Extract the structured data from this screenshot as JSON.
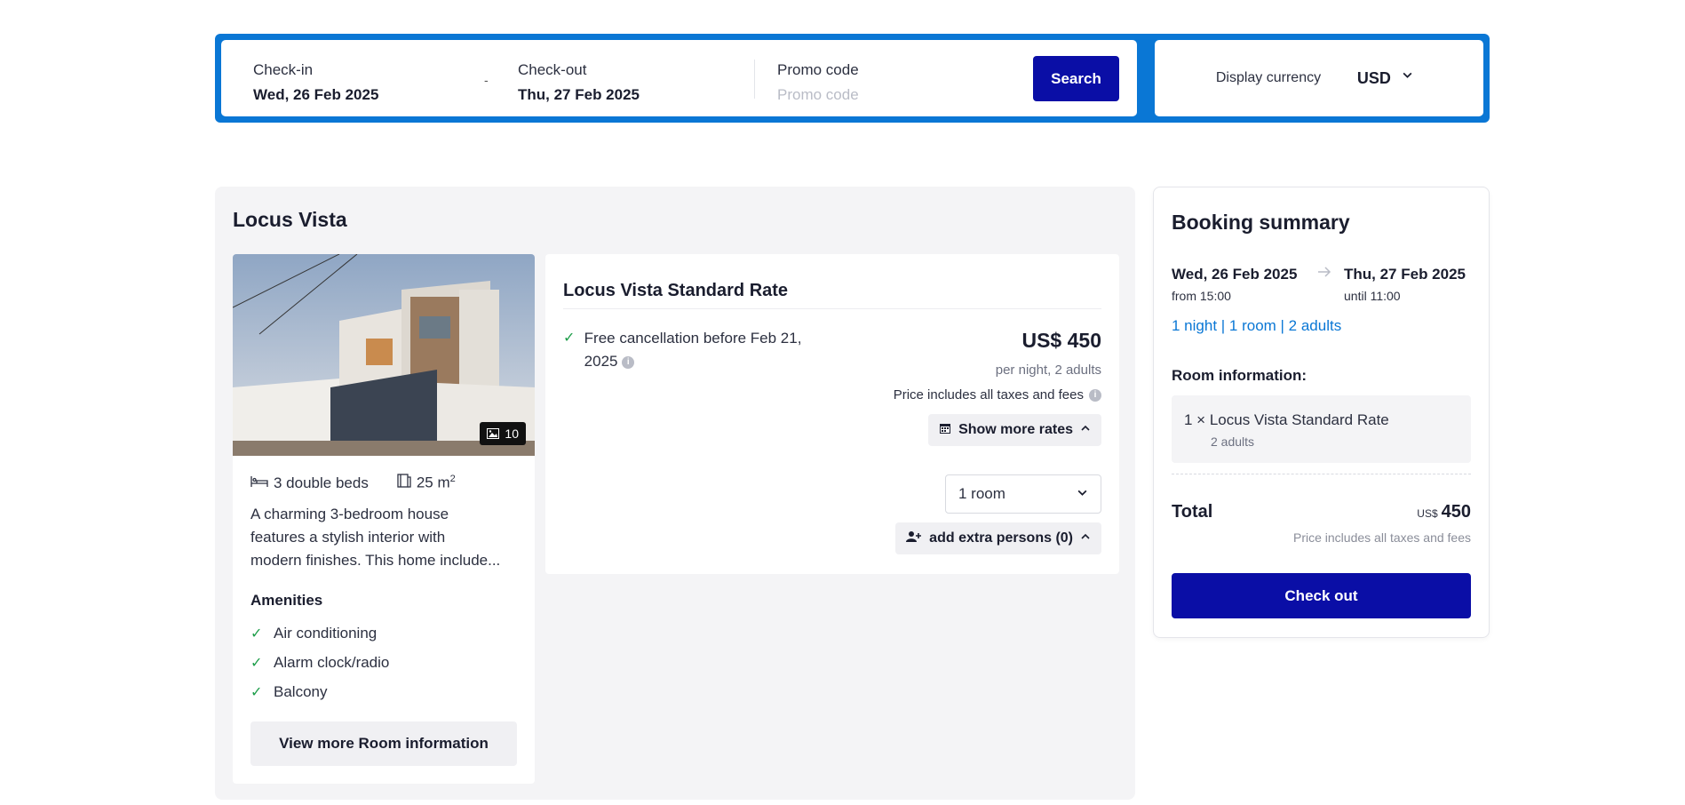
{
  "search": {
    "checkin_label": "Check-in",
    "checkin_value": "Wed, 26 Feb 2025",
    "separator": "-",
    "checkout_label": "Check-out",
    "checkout_value": "Thu, 27 Feb 2025",
    "promo_label": "Promo code",
    "promo_placeholder": "Promo code",
    "search_button": "Search"
  },
  "currency": {
    "label": "Display currency",
    "value": "USD"
  },
  "hotel": {
    "name": "Locus Vista"
  },
  "room": {
    "photo_count": "10",
    "beds": "3 double beds",
    "size": "25 m",
    "size_exp": "2",
    "description_l1": "A charming 3-bedroom house",
    "description_l2": "features a stylish interior with",
    "description_l3": "modern finishes. This home include...",
    "amenities_title": "Amenities",
    "amenities": [
      "Air conditioning",
      "Alarm clock/radio",
      "Balcony"
    ],
    "view_more": "View more Room information"
  },
  "rate": {
    "title": "Locus Vista Standard Rate",
    "cancellation": "Free cancellation before Feb 21, 2025",
    "price": "US$ 450",
    "per_night": "per night, 2 adults",
    "taxes": "Price includes all taxes and fees",
    "show_more_rates": "Show more rates",
    "room_select": "1 room",
    "extra_persons": "add extra persons (0)"
  },
  "summary": {
    "title": "Booking summary",
    "checkin_date": "Wed, 26 Feb 2025",
    "checkout_date": "Thu, 27 Feb 2025",
    "checkin_time": "from 15:00",
    "checkout_time": "until 11:00",
    "stay": "1 night | 1 room | 2 adults",
    "room_info_title": "Room information:",
    "room_line": "1 × Locus Vista Standard Rate",
    "room_guests": "2 adults",
    "total_label": "Total",
    "total_currency": "US$",
    "total_amount": "450",
    "total_note": "Price includes all taxes and fees",
    "checkout_button": "Check out"
  },
  "colors": {
    "brand_blue": "#0a77d5",
    "button_navy": "#0a0ea6",
    "check_green": "#1e9e4a"
  }
}
